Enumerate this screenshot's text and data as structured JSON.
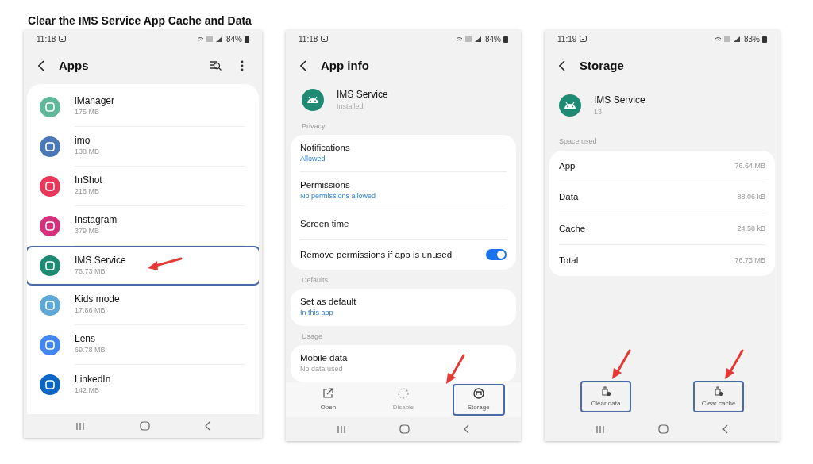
{
  "title": "Clear the IMS Service App Cache and Data",
  "screens": [
    {
      "kind": "app_list",
      "time": "11:18",
      "battery": "84%",
      "heading": "Apps",
      "apps": [
        {
          "name": "iManager",
          "size": "175 MB",
          "color": "#5fb89a",
          "highlighted": false
        },
        {
          "name": "imo",
          "size": "138 MB",
          "color": "#4a78b8",
          "highlighted": false
        },
        {
          "name": "InShot",
          "size": "216 MB",
          "color": "#e8385a",
          "highlighted": false
        },
        {
          "name": "Instagram",
          "size": "379 MB",
          "color": "#d4307c",
          "highlighted": false
        },
        {
          "name": "IMS Service",
          "size": "76.73 MB",
          "color": "#1f8a72",
          "highlighted": true
        },
        {
          "name": "Kids mode",
          "size": "17.86 MB",
          "color": "#5ea8d8",
          "highlighted": false
        },
        {
          "name": "Lens",
          "size": "69.78 MB",
          "color": "#4285f4",
          "highlighted": false
        },
        {
          "name": "LinkedIn",
          "size": "142 MB",
          "color": "#0a66c2",
          "highlighted": false
        }
      ]
    },
    {
      "kind": "app_info",
      "time": "11:18",
      "battery": "84%",
      "heading": "App info",
      "app": {
        "name": "IMS Service",
        "subtitle": "Installed"
      },
      "sections": [
        {
          "header": "Privacy",
          "rows": [
            {
              "kind": "link",
              "title": "Notifications",
              "subtitle": "Allowed"
            },
            {
              "kind": "link",
              "title": "Permissions",
              "subtitle": "No permissions allowed"
            },
            {
              "kind": "link",
              "title": "Screen time"
            },
            {
              "kind": "toggle",
              "title": "Remove permissions if app is unused",
              "on": true
            }
          ]
        },
        {
          "header": "Defaults",
          "rows": [
            {
              "kind": "link",
              "title": "Set as default",
              "subtitle": "In this app"
            }
          ]
        },
        {
          "header": "Usage",
          "rows": [
            {
              "kind": "plain",
              "title": "Mobile data",
              "subtitle": "No data used"
            }
          ]
        }
      ],
      "actions": [
        {
          "label": "Open",
          "kind": "open",
          "highlighted": false
        },
        {
          "label": "Disable",
          "kind": "disable",
          "highlighted": false
        },
        {
          "label": "Storage",
          "kind": "storage",
          "highlighted": true
        }
      ]
    },
    {
      "kind": "storage",
      "time": "11:19",
      "battery": "83%",
      "heading": "Storage",
      "app": {
        "name": "IMS Service",
        "subtitle": "13"
      },
      "section": "Space used",
      "rows": [
        {
          "label": "App",
          "value": "76.64 MB"
        },
        {
          "label": "Data",
          "value": "88.06 kB"
        },
        {
          "label": "Cache",
          "value": "24.58 kB"
        },
        {
          "label": "Total",
          "value": "76.73 MB"
        }
      ],
      "actions": [
        {
          "label": "Clear data",
          "highlighted": true
        },
        {
          "label": "Clear cache",
          "highlighted": true
        }
      ]
    }
  ]
}
